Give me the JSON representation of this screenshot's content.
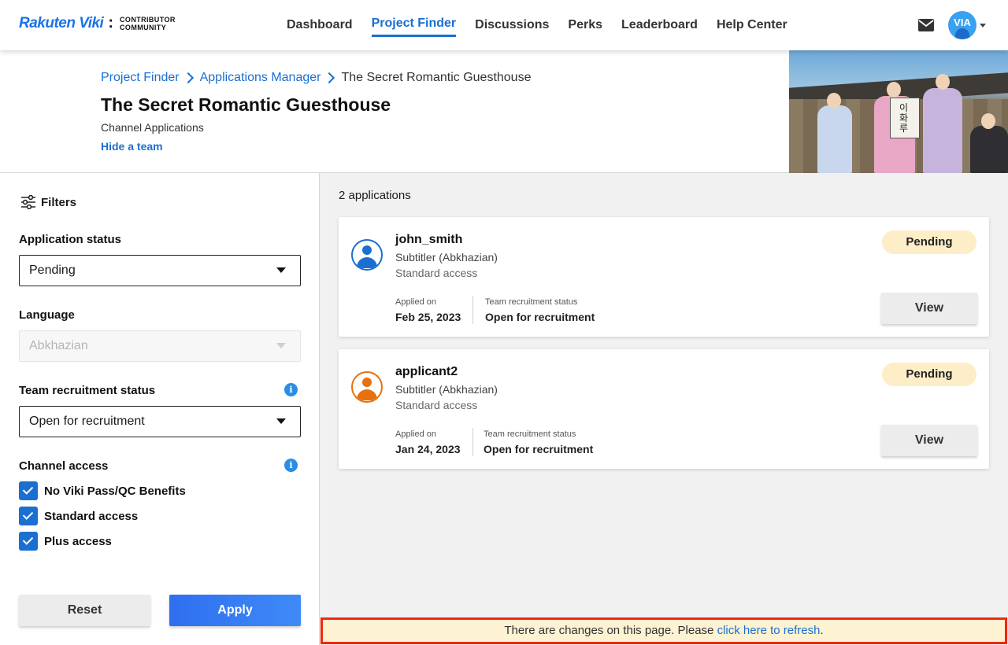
{
  "header": {
    "logo_main": "Rakuten Viki",
    "logo_colon": ":",
    "logo_sub_line1": "CONTRIBUTOR",
    "logo_sub_line2": "COMMUNITY",
    "nav": [
      "Dashboard",
      "Project Finder",
      "Discussions",
      "Perks",
      "Leaderboard",
      "Help Center"
    ],
    "active_nav": "Project Finder",
    "avatar_text": "VIA"
  },
  "hero": {
    "breadcrumb": [
      "Project Finder",
      "Applications Manager",
      "The Secret Romantic Guesthouse"
    ],
    "title": "The Secret Romantic Guesthouse",
    "subtitle": "Channel Applications",
    "hide_link": "Hide a team",
    "sign_text": "이화루"
  },
  "filters": {
    "heading": "Filters",
    "app_status_label": "Application status",
    "app_status_value": "Pending",
    "language_label": "Language",
    "language_value": "Abkhazian",
    "team_status_label": "Team recruitment status",
    "team_status_value": "Open for recruitment",
    "channel_access_label": "Channel access",
    "access_options": [
      "No Viki Pass/QC Benefits",
      "Standard access",
      "Plus access"
    ],
    "info_glyph": "i",
    "reset_label": "Reset",
    "apply_label": "Apply"
  },
  "main": {
    "count_text": "2 applications",
    "applied_on_label": "Applied on",
    "team_status_label": "Team recruitment status",
    "view_label": "View",
    "applications": [
      {
        "username": "john_smith",
        "role": "Subtitler (Abkhazian)",
        "access": "Standard access",
        "status": "Pending",
        "applied_on": "Feb 25, 2023",
        "team_status": "Open for recruitment",
        "avatar_color": "#1a6fd1"
      },
      {
        "username": "applicant2",
        "role": "Subtitler (Abkhazian)",
        "access": "Standard access",
        "status": "Pending",
        "applied_on": "Jan 24, 2023",
        "team_status": "Open for recruitment",
        "avatar_color": "#e8700f"
      }
    ]
  },
  "refresh": {
    "text": "There are changes on this page. Please ",
    "link": "click here to refresh",
    "end": "."
  },
  "colors": {
    "accent": "#1a6fd1",
    "badge_pending": "#fdeec7",
    "refresh_border": "#f0280f"
  }
}
